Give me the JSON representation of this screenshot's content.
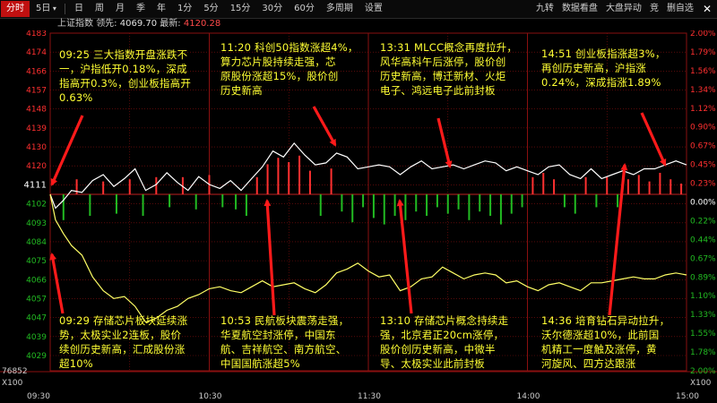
{
  "toolbar": {
    "tabs": [
      "分时",
      "5日",
      "日",
      "周",
      "月",
      "季",
      "年",
      "1分",
      "5分",
      "15分",
      "30分",
      "60分",
      "多周期",
      "设置"
    ],
    "active_index": 0,
    "right": [
      "九转",
      "数据看盘",
      "大盘异动",
      "竞",
      "删自选"
    ]
  },
  "info": {
    "name": "上证指数",
    "lead_label": "领先:",
    "lead_value": "4069.70",
    "latest_label": "最新:",
    "latest_value": "4120.28"
  },
  "colors": {
    "up": "#ff3030",
    "down": "#22bb22",
    "price_line": "#ffffff",
    "lead_line": "#ffff66",
    "annotation": "#ffff33",
    "arrow": "#ff1a1a",
    "grid": "#8a1010"
  },
  "chart_data": {
    "type": "line",
    "title": "",
    "time_labels": [
      "09:30",
      "10:30",
      "11:30",
      "14:00",
      "15:00"
    ],
    "left_axis": [
      "4183",
      "4174",
      "4166",
      "4157",
      "4148",
      "4139",
      "4130",
      "4120",
      "4111",
      "4102",
      "4093",
      "4084",
      "4075",
      "4066",
      "4057",
      "4047",
      "4039",
      "4029"
    ],
    "right_axis": [
      "2.00%",
      "1.79%",
      "1.56%",
      "1.34%",
      "1.12%",
      "0.90%",
      "0.67%",
      "0.45%",
      "0.23%",
      "0.00%",
      "0.22%",
      "0.44%",
      "0.67%",
      "0.89%",
      "1.10%",
      "1.33%",
      "1.55%",
      "1.78%",
      "2.00%"
    ],
    "volume_label": "76852",
    "volume_unit": "X100",
    "prev_close": 4111,
    "ylim": [
      4029,
      4193
    ],
    "series": [
      {
        "name": "",
        "t": [
          0,
          2,
          5,
          8,
          12,
          16,
          20,
          24,
          28,
          32,
          36,
          40,
          44,
          48,
          52,
          56,
          60,
          64,
          68,
          72,
          76,
          80,
          84,
          88,
          92,
          96,
          100,
          104,
          108,
          112,
          116,
          120,
          124,
          128,
          132,
          136,
          140,
          144,
          148,
          152,
          156,
          160,
          164,
          168,
          172,
          176,
          180,
          184,
          188,
          192,
          196,
          200,
          204,
          208,
          212,
          216,
          220,
          224,
          228,
          232,
          236,
          240
        ],
        "values": [
          4111,
          4104,
          4108,
          4113,
          4112,
          4118,
          4121,
          4115,
          4119,
          4124,
          4113,
          4116,
          4122,
          4117,
          4113,
          4120,
          4116,
          4114,
          4118,
          4113,
          4119,
          4125,
          4133,
          4130,
          4137,
          4131,
          4126,
          4127,
          4132,
          4130,
          4124,
          4125,
          4126,
          4125,
          4121,
          4125,
          4128,
          4124,
          4125,
          4126,
          4124,
          4126,
          4128,
          4127,
          4123,
          4125,
          4123,
          4121,
          4125,
          4126,
          4121,
          4119,
          4124,
          4119,
          4121,
          4123,
          4121,
          4124,
          4124,
          4126,
          4128,
          4126
        ]
      },
      {
        "name": "",
        "t": [
          0,
          2,
          5,
          8,
          12,
          16,
          20,
          24,
          28,
          32,
          36,
          40,
          44,
          48,
          52,
          56,
          60,
          64,
          68,
          72,
          76,
          80,
          84,
          88,
          92,
          96,
          100,
          104,
          108,
          112,
          116,
          120,
          124,
          128,
          132,
          136,
          140,
          144,
          148,
          152,
          156,
          160,
          164,
          168,
          172,
          176,
          180,
          184,
          188,
          192,
          196,
          200,
          204,
          208,
          212,
          216,
          220,
          224,
          228,
          232,
          236,
          240
        ],
        "values": [
          4111,
          4098,
          4091,
          4085,
          4080,
          4069,
          4062,
          4058,
          4059,
          4054,
          4046,
          4048,
          4052,
          4054,
          4058,
          4060,
          4063,
          4064,
          4062,
          4061,
          4064,
          4067,
          4064,
          4065,
          4066,
          4063,
          4061,
          4065,
          4071,
          4073,
          4076,
          4072,
          4069,
          4070,
          4062,
          4064,
          4068,
          4069,
          4074,
          4071,
          4068,
          4070,
          4071,
          4070,
          4066,
          4067,
          4064,
          4062,
          4065,
          4066,
          4064,
          4062,
          4066,
          4066,
          4067,
          4068,
          4069,
          4068,
          4068,
          4070,
          4071,
          4070
        ]
      }
    ],
    "volume_bars": [
      {
        "t": 5,
        "v": 0.6,
        "s": -1
      },
      {
        "t": 10,
        "v": 0.35,
        "s": 1
      },
      {
        "t": 15,
        "v": 0.5,
        "s": -1
      },
      {
        "t": 20,
        "v": 0.3,
        "s": 1
      },
      {
        "t": 25,
        "v": 0.45,
        "s": -1
      },
      {
        "t": 30,
        "v": 0.35,
        "s": 1
      },
      {
        "t": 35,
        "v": 0.5,
        "s": -1
      },
      {
        "t": 40,
        "v": 0.4,
        "s": 1
      },
      {
        "t": 45,
        "v": 0.3,
        "s": -1
      },
      {
        "t": 50,
        "v": 0.4,
        "s": 1
      },
      {
        "t": 55,
        "v": 0.35,
        "s": -1
      },
      {
        "t": 60,
        "v": 0.45,
        "s": 1
      },
      {
        "t": 65,
        "v": 0.3,
        "s": -1
      },
      {
        "t": 70,
        "v": 0.35,
        "s": -1
      },
      {
        "t": 74,
        "v": 0.5,
        "s": -1
      },
      {
        "t": 78,
        "v": 0.4,
        "s": 1
      },
      {
        "t": 82,
        "v": 0.7,
        "s": 1
      },
      {
        "t": 86,
        "v": 0.85,
        "s": 1
      },
      {
        "t": 90,
        "v": 0.75,
        "s": 1
      },
      {
        "t": 94,
        "v": 0.9,
        "s": 1
      },
      {
        "t": 98,
        "v": 0.55,
        "s": 1
      },
      {
        "t": 102,
        "v": 0.5,
        "s": -1
      },
      {
        "t": 106,
        "v": 0.6,
        "s": 1
      },
      {
        "t": 110,
        "v": 0.4,
        "s": -1
      },
      {
        "t": 114,
        "v": 0.65,
        "s": -1
      },
      {
        "t": 118,
        "v": 0.3,
        "s": -1
      },
      {
        "t": 122,
        "v": 0.55,
        "s": -1
      },
      {
        "t": 126,
        "v": 0.7,
        "s": -1
      },
      {
        "t": 130,
        "v": 0.5,
        "s": -1
      },
      {
        "t": 134,
        "v": 0.6,
        "s": -1
      },
      {
        "t": 138,
        "v": 0.4,
        "s": -1
      },
      {
        "t": 142,
        "v": 0.5,
        "s": -1
      },
      {
        "t": 146,
        "v": 0.3,
        "s": -1
      },
      {
        "t": 150,
        "v": 0.45,
        "s": -1
      },
      {
        "t": 154,
        "v": 0.35,
        "s": -1
      },
      {
        "t": 158,
        "v": 0.6,
        "s": -1
      },
      {
        "t": 162,
        "v": 0.4,
        "s": -1
      },
      {
        "t": 166,
        "v": 0.5,
        "s": -1
      },
      {
        "t": 170,
        "v": 0.7,
        "s": -1
      },
      {
        "t": 174,
        "v": 0.45,
        "s": -1
      },
      {
        "t": 178,
        "v": 0.3,
        "s": -1
      },
      {
        "t": 182,
        "v": 0.4,
        "s": 1
      },
      {
        "t": 186,
        "v": 0.5,
        "s": 1
      },
      {
        "t": 190,
        "v": 0.35,
        "s": 1
      },
      {
        "t": 194,
        "v": 0.3,
        "s": -1
      },
      {
        "t": 198,
        "v": 0.45,
        "s": -1
      },
      {
        "t": 202,
        "v": 0.4,
        "s": 1
      },
      {
        "t": 206,
        "v": 0.3,
        "s": -1
      },
      {
        "t": 210,
        "v": 0.4,
        "s": 1
      },
      {
        "t": 214,
        "v": 0.3,
        "s": -1
      },
      {
        "t": 218,
        "v": 0.35,
        "s": 1
      },
      {
        "t": 222,
        "v": 0.45,
        "s": 1
      },
      {
        "t": 226,
        "v": 0.3,
        "s": 1
      },
      {
        "t": 230,
        "v": 0.5,
        "s": 1
      },
      {
        "t": 234,
        "v": 0.35,
        "s": 1
      },
      {
        "t": 238,
        "v": 0.25,
        "s": 1
      }
    ]
  },
  "annotations": [
    {
      "id": "n1",
      "text": "09:25 三大指数开盘涨跌不\n一，沪指低开0.18%，深成\n指高开0.3%，创业板指高开\n0.63%"
    },
    {
      "id": "n2",
      "text": "11:20 科创50指数涨超4%，\n算力芯片股持续走强，芯\n原股份涨超15%，股价创\n历史新高"
    },
    {
      "id": "n3",
      "text": "13:31 MLCC概念再度拉升，\n风华高科午后涨停，股价创\n历史新高，博迁新材、火炬\n电子、鸿远电子此前封板"
    },
    {
      "id": "n4",
      "text": "14:51 创业板指涨超3%，\n再创历史新高，沪指涨\n0.24%，深成指涨1.89%"
    },
    {
      "id": "n5",
      "text": "09:29 存储芯片板块延续涨\n势，太极实业2连板，股价\n续创历史新高，汇成股份涨\n超10%"
    },
    {
      "id": "n6",
      "text": "10:53 民航板块震荡走强，\n华夏航空封涨停，中国东\n航、吉祥航空、南方航空、\n中国国航涨超5%"
    },
    {
      "id": "n7",
      "text": "13:10 存储芯片概念持续走\n强，北京君正20cm涨停，\n股价创历史新高，中微半\n导、太极实业此前封板"
    },
    {
      "id": "n8",
      "text": "14:36 培育钻石异动拉升，\n沃尔德涨超10%，此前国\n机精工一度触及涨停，黄\n河旋风、四方达跟涨"
    }
  ]
}
